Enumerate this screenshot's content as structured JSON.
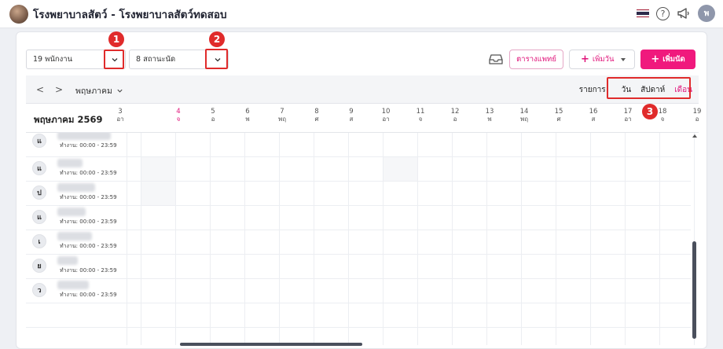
{
  "header": {
    "title": "โรงพยาบาลสัตว์ - โรงพยาบาลสัตว์ทดสอบ",
    "avatar_initial": "พ",
    "help_glyph": "?"
  },
  "filters": {
    "staff_select": "19 พนักงาน",
    "status_select": "8 สถานะนัด"
  },
  "annotations": [
    "1",
    "2",
    "3"
  ],
  "toolbar": {
    "schedule_button": "ตารางแพทย์",
    "add_day_button": "เพิ่มวัน",
    "add_appointment_button": "เพิ่มนัด",
    "plus_glyph": "+"
  },
  "calendar_nav": {
    "prev_glyph": "<",
    "next_glyph": ">",
    "month": "พฤษภาคม"
  },
  "view_tabs": {
    "list": "รายการ",
    "day": "วัน",
    "week": "สัปดาห์",
    "month": "เดือน"
  },
  "grid": {
    "month_label": "พฤษภาคม 2569",
    "days": [
      {
        "num": "3",
        "wd": "อา"
      },
      {
        "num": "4",
        "wd": "จ"
      },
      {
        "num": "5",
        "wd": "อ"
      },
      {
        "num": "6",
        "wd": "พ"
      },
      {
        "num": "7",
        "wd": "พฤ"
      },
      {
        "num": "8",
        "wd": "ศ"
      },
      {
        "num": "9",
        "wd": "ส"
      },
      {
        "num": "10",
        "wd": "อา"
      },
      {
        "num": "11",
        "wd": "จ"
      },
      {
        "num": "12",
        "wd": "อ"
      },
      {
        "num": "13",
        "wd": "พ"
      },
      {
        "num": "14",
        "wd": "พฤ"
      },
      {
        "num": "15",
        "wd": "ศ"
      },
      {
        "num": "16",
        "wd": "ส"
      },
      {
        "num": "17",
        "wd": "อา"
      },
      {
        "num": "18",
        "wd": "จ"
      },
      {
        "num": "19",
        "wd": "อ"
      }
    ],
    "today_index": 1
  },
  "staff": [
    {
      "initial": "แ",
      "hours": "ทำงาน: 00:00 - 23:59"
    },
    {
      "initial": "แ",
      "hours": "ทำงาน: 00:00 - 23:59"
    },
    {
      "initial": "ป",
      "hours": "ทำงาน: 00:00 - 23:59"
    },
    {
      "initial": "แ",
      "hours": "ทำงาน: 00:00 - 23:59"
    },
    {
      "initial": "เ",
      "hours": "ทำงาน: 00:00 - 23:59"
    },
    {
      "initial": "ย",
      "hours": "ทำงาน: 00:00 - 23:59"
    },
    {
      "initial": "ว",
      "hours": "ทำงาน: 00:00 - 23:59"
    }
  ],
  "colors": {
    "accent": "#f0197d",
    "annotation": "#e02b2b"
  }
}
